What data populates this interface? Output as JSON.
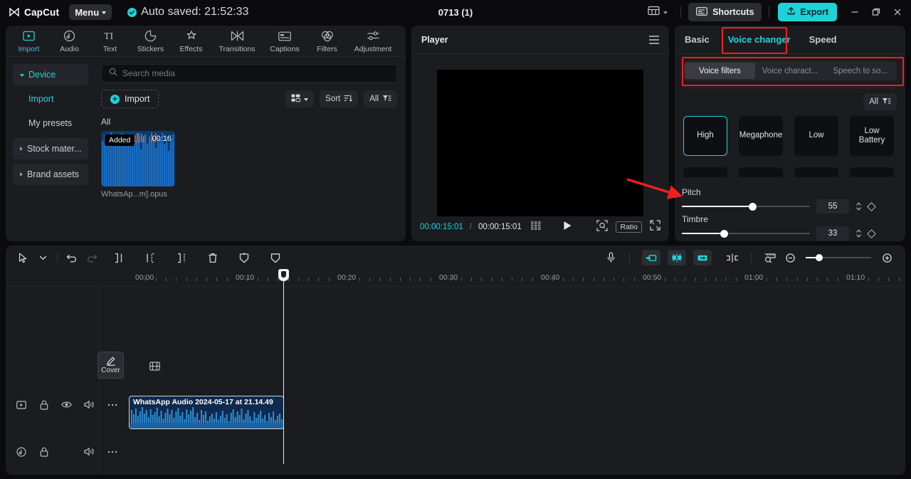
{
  "titlebar": {
    "app_name": "CapCut",
    "menu_label": "Menu",
    "autosave_text": "Auto saved: 21:52:33",
    "project_title": "0713 (1)",
    "shortcuts_label": "Shortcuts",
    "export_label": "Export",
    "icons": {
      "layout": "layout-icon",
      "shortcuts": "keyboard-icon",
      "export": "upload-icon",
      "minimize": "minimize-icon",
      "maximize": "maximize-icon",
      "close": "close-icon"
    }
  },
  "media_panel": {
    "tabs": [
      {
        "label": "Import",
        "icon": "import-icon",
        "active": true
      },
      {
        "label": "Audio",
        "icon": "audio-note-icon",
        "active": false
      },
      {
        "label": "Text",
        "icon": "text-ti-icon",
        "active": false
      },
      {
        "label": "Stickers",
        "icon": "sticker-icon",
        "active": false
      },
      {
        "label": "Effects",
        "icon": "effects-icon",
        "active": false
      },
      {
        "label": "Transitions",
        "icon": "transitions-icon",
        "active": false
      },
      {
        "label": "Captions",
        "icon": "captions-icon",
        "active": false
      },
      {
        "label": "Filters",
        "icon": "filters-icon",
        "active": false
      },
      {
        "label": "Adjustment",
        "icon": "adjustment-icon",
        "active": false
      }
    ],
    "nav": [
      {
        "label": "Device",
        "type": "group",
        "expanded": true,
        "selected": false
      },
      {
        "label": "Import",
        "type": "child",
        "selected": true
      },
      {
        "label": "My presets",
        "type": "child",
        "selected": false
      },
      {
        "label": "Stock mater...",
        "type": "group",
        "expanded": false,
        "selected": false
      },
      {
        "label": "Brand assets",
        "type": "group",
        "expanded": false,
        "selected": false
      }
    ],
    "search_placeholder": "Search media",
    "import_label": "Import",
    "sort_label": "Sort",
    "filter_label": "All",
    "section_label": "All",
    "items": [
      {
        "name": "WhatsAp...m].opus",
        "duration": "00:16",
        "badge": "Added"
      }
    ]
  },
  "player": {
    "title": "Player",
    "current_time": "00:00:15:01",
    "separator": "/",
    "total_time": "00:00:15:01",
    "ratio_label": "Ratio",
    "icons": {
      "menu": "hamburger-icon",
      "frames": "frames-icon",
      "play": "play-icon",
      "zoom_fit": "zoom-fit-icon",
      "fullscreen": "fullscreen-icon"
    }
  },
  "right_panel": {
    "tabs": [
      {
        "label": "Basic",
        "active": false
      },
      {
        "label": "Voice changer",
        "active": true
      },
      {
        "label": "Speed",
        "active": false
      }
    ],
    "segments": [
      {
        "label": "Voice filters",
        "active": true
      },
      {
        "label": "Voice charact...",
        "active": false
      },
      {
        "label": "Speech to so...",
        "active": false
      }
    ],
    "filter_label": "All",
    "presets": [
      {
        "label": "High",
        "active": true
      },
      {
        "label": "Megaphone",
        "active": false
      },
      {
        "label": "Low",
        "active": false
      },
      {
        "label": "Low Battery",
        "active": false
      }
    ],
    "params": [
      {
        "label": "Pitch",
        "value": "55",
        "percent": 55
      },
      {
        "label": "Timbre",
        "value": "33",
        "percent": 33
      }
    ],
    "highlight_color": "#f01f1f",
    "accent_color": "#1fd2d8"
  },
  "timeline": {
    "toolbar_left": [
      {
        "icon": "select-arrow-icon"
      },
      {
        "icon": "chevron-down-icon"
      },
      {
        "icon": "undo-icon"
      },
      {
        "icon": "redo-icon"
      },
      {
        "icon": "split-icon"
      },
      {
        "icon": "trim-left-icon"
      },
      {
        "icon": "trim-right-icon"
      },
      {
        "icon": "delete-icon"
      },
      {
        "icon": "freeze-icon"
      },
      {
        "icon": "mirror-icon"
      }
    ],
    "toolbar_right": [
      {
        "icon": "microphone-icon"
      },
      {
        "icon": "keyframe-in-icon"
      },
      {
        "icon": "auto-adjust-icon"
      },
      {
        "icon": "keyframe-out-icon"
      },
      {
        "icon": "snap-icon"
      },
      {
        "icon": "ruler-zoom-icon"
      },
      {
        "icon": "zoom-out-icon"
      },
      {
        "icon": "zoom-in-icon"
      }
    ],
    "ruler_labels": [
      "00:00",
      "00:10",
      "00:20",
      "00:30",
      "00:40",
      "00:50",
      "01:00",
      "01:10"
    ],
    "playhead_time": "00:00:15:01",
    "cover_label": "Cover",
    "video_track_icons": [
      "clip-icon",
      "lock-icon",
      "eye-icon",
      "volume-icon",
      "more-icon"
    ],
    "audio_track_icons": [
      "audio-note-icon",
      "lock-icon",
      "volume-icon",
      "more-icon"
    ],
    "clips": [
      {
        "name": "WhatsApp Audio 2024-05-17 at 21.14.49",
        "type": "audio"
      }
    ]
  }
}
